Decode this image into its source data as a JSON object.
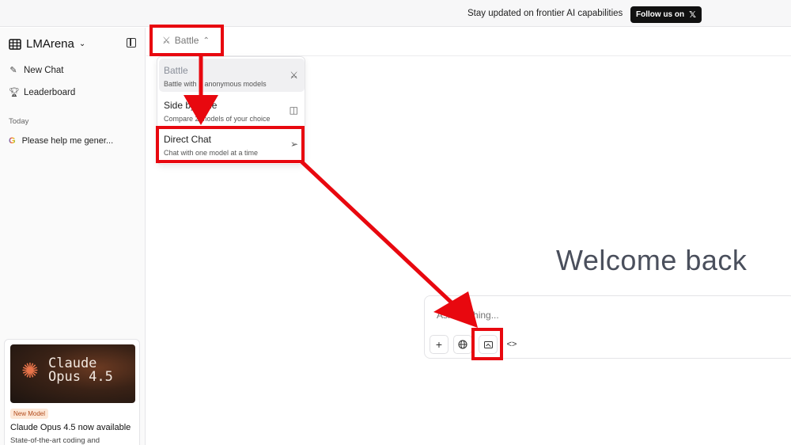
{
  "banner": {
    "text": "Stay updated on frontier AI capabilities",
    "follow_label": "Follow us on",
    "x_icon": "x-logo-icon"
  },
  "sidebar": {
    "brand": "LMArena",
    "items": [
      {
        "label": "New Chat",
        "icon": "edit-icon"
      },
      {
        "label": "Leaderboard",
        "icon": "trophy-icon"
      }
    ],
    "section_today": "Today",
    "history": [
      {
        "label": "Please help me gener...",
        "icon": "google-icon"
      }
    ],
    "promo": {
      "image_title_line1": "Claude",
      "image_title_line2": "Opus 4.5",
      "badge": "New Model",
      "headline": "Claude Opus 4.5 now available",
      "description": "State-of-the-art coding and"
    }
  },
  "header": {
    "mode_label": "Battle"
  },
  "dropdown": {
    "items": [
      {
        "title": "Battle",
        "desc": "Battle with 2 anonymous models",
        "icon": "swords-icon",
        "active": true
      },
      {
        "title": "Side by Side",
        "desc": "Compare 2 models of your choice",
        "icon": "columns-icon",
        "active": false
      },
      {
        "title": "Direct Chat",
        "desc": "Chat with one model at a time",
        "icon": "send-icon",
        "active": false
      }
    ]
  },
  "main": {
    "welcome": "Welcome back",
    "input_placeholder": "Ask anything...",
    "tools": [
      {
        "name": "attach",
        "icon": "plus-icon"
      },
      {
        "name": "web-search",
        "icon": "globe-icon"
      },
      {
        "name": "image",
        "icon": "image-icon"
      },
      {
        "name": "code",
        "icon": "code-icon"
      }
    ]
  },
  "annotation": {
    "color": "#e8080f"
  }
}
